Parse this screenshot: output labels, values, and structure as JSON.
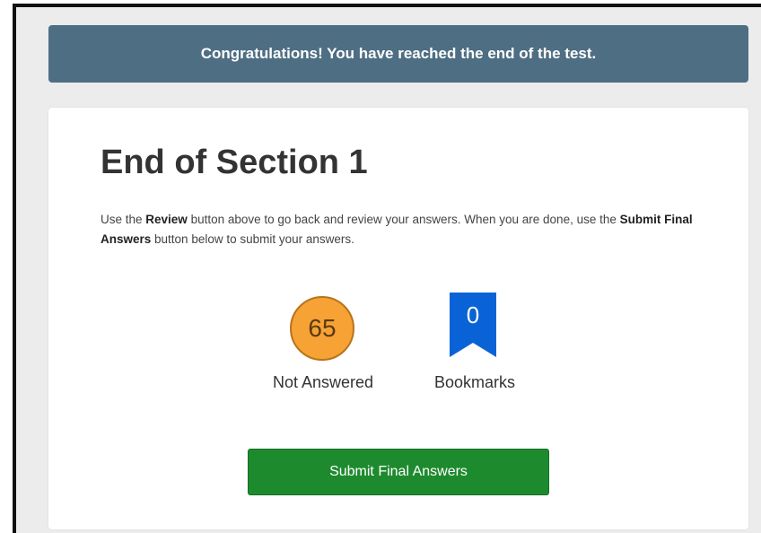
{
  "banner": {
    "message": "Congratulations! You have reached the end of the test."
  },
  "section": {
    "title": "End of Section 1",
    "instructions": {
      "part1": "Use the ",
      "review_label": "Review",
      "part2": " button above to go back and review your answers. When you are done, use the ",
      "submit_label": "Submit Final Answers",
      "part3": " button below to submit your answers."
    }
  },
  "stats": {
    "not_answered": {
      "count": "65",
      "label": "Not Answered",
      "color": "#f6a235"
    },
    "bookmarks": {
      "count": "0",
      "label": "Bookmarks",
      "icon": "bookmark-icon",
      "color": "#0a63d6"
    }
  },
  "actions": {
    "submit_label": "Submit Final Answers",
    "submit_color": "#1e8a2e"
  },
  "theme": {
    "banner_color": "#4e6e83"
  }
}
